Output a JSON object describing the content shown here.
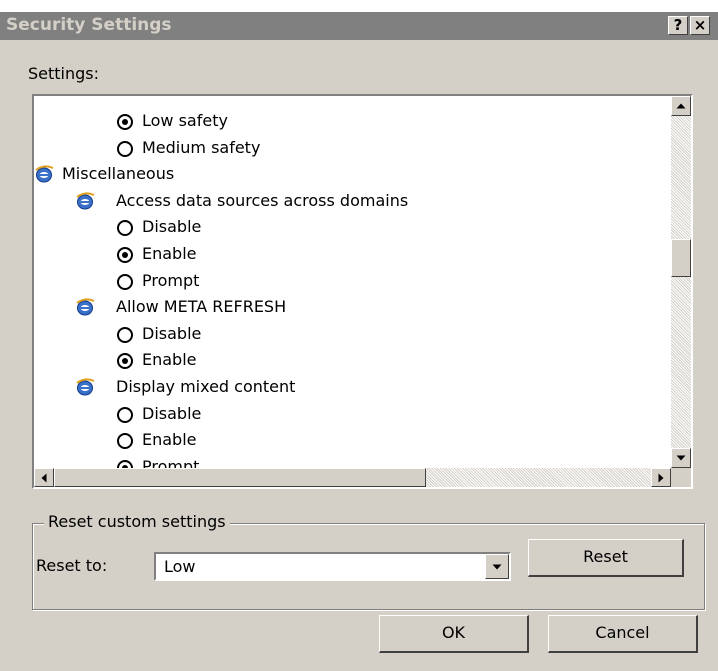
{
  "window": {
    "title": "Security Settings",
    "help_button": "?",
    "close_button": "×"
  },
  "settings_label": "Settings:",
  "tree": {
    "rows": [
      {
        "kind": "radio",
        "label": "Low safety",
        "checked": true
      },
      {
        "kind": "radio",
        "label": "Medium safety",
        "checked": false
      },
      {
        "kind": "category",
        "label": "Miscellaneous"
      },
      {
        "kind": "setting",
        "label": "Access data sources across domains"
      },
      {
        "kind": "radio",
        "label": "Disable",
        "checked": false
      },
      {
        "kind": "radio",
        "label": "Enable",
        "checked": true
      },
      {
        "kind": "radio",
        "label": "Prompt",
        "checked": false
      },
      {
        "kind": "setting",
        "label": "Allow META REFRESH"
      },
      {
        "kind": "radio",
        "label": "Disable",
        "checked": false
      },
      {
        "kind": "radio",
        "label": "Enable",
        "checked": true
      },
      {
        "kind": "setting",
        "label": "Display mixed content"
      },
      {
        "kind": "radio",
        "label": "Disable",
        "checked": false
      },
      {
        "kind": "radio",
        "label": "Enable",
        "checked": false
      },
      {
        "kind": "radio",
        "label": "Prompt",
        "checked": true
      }
    ]
  },
  "reset_group": {
    "legend": "Reset custom settings",
    "reset_to_label": "Reset to:",
    "selected_value": "Low",
    "reset_button": "Reset"
  },
  "footer": {
    "ok_button": "OK",
    "cancel_button": "Cancel"
  },
  "colors": {
    "face": "#d4d0c8",
    "titlebar_inactive": "#808080",
    "title_text": "#d4d0c8",
    "list_background": "#ffffff"
  }
}
